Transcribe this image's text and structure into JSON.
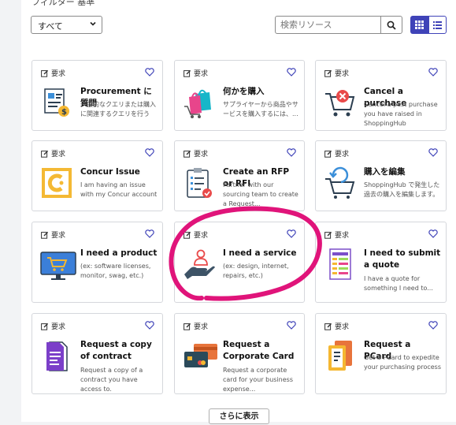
{
  "filter": {
    "label": "フィルター 基準",
    "selected": "すべて"
  },
  "search": {
    "placeholder": "検索リソース"
  },
  "tag_label": "要求",
  "cards": [
    {
      "title": "Procurement に質問",
      "desc": "一般的なクエリまたは購入に関連するクエリを行う",
      "icon": "procurement-question-icon"
    },
    {
      "title": "何かを購入",
      "desc": "サプライヤーから商品やサービスを購入するには、...",
      "icon": "shopping-bag-icon"
    },
    {
      "title": "Cancel a purchase",
      "desc": "Cancel a past purchase you have raised in ShoppingHub",
      "icon": "cart-cancel-icon"
    },
    {
      "title": "Concur Issue",
      "desc": "I am having an issue with my Concur account",
      "icon": "concur-logo-icon"
    },
    {
      "title": "Create an RFP or RFI",
      "desc": "Partner with our sourcing team to create a Request...",
      "icon": "clipboard-checklist-icon"
    },
    {
      "title": "購入を編集",
      "desc": "ShoppingHub で発生した過去の購入を編集します。",
      "icon": "cart-edit-icon"
    },
    {
      "title": "I need a product",
      "desc": "(ex: software licenses, monitor, swag, etc.)",
      "icon": "monitor-cart-icon"
    },
    {
      "title": "I need a service",
      "desc": "(ex: design, internet, repairs, etc.)",
      "icon": "hand-service-icon"
    },
    {
      "title": "I need to submit a quote",
      "desc": "I have a quote for something I need to...",
      "icon": "quote-spreadsheet-icon"
    },
    {
      "title": "Request a copy of contract",
      "desc": "Request a copy of a contract you have access to.",
      "icon": "contract-document-icon"
    },
    {
      "title": "Request a Corporate Card",
      "desc": "Request a corporate card for your business expense...",
      "icon": "credit-cards-icon"
    },
    {
      "title": "Request a PCard",
      "desc": "Get a PCard to expedite your purchasing process",
      "icon": "pcard-icon"
    }
  ],
  "more_button": "さらに表示",
  "colors": {
    "accent": "#3f43b8",
    "annotation": "#e0147a",
    "heart": "#3f43b8"
  }
}
